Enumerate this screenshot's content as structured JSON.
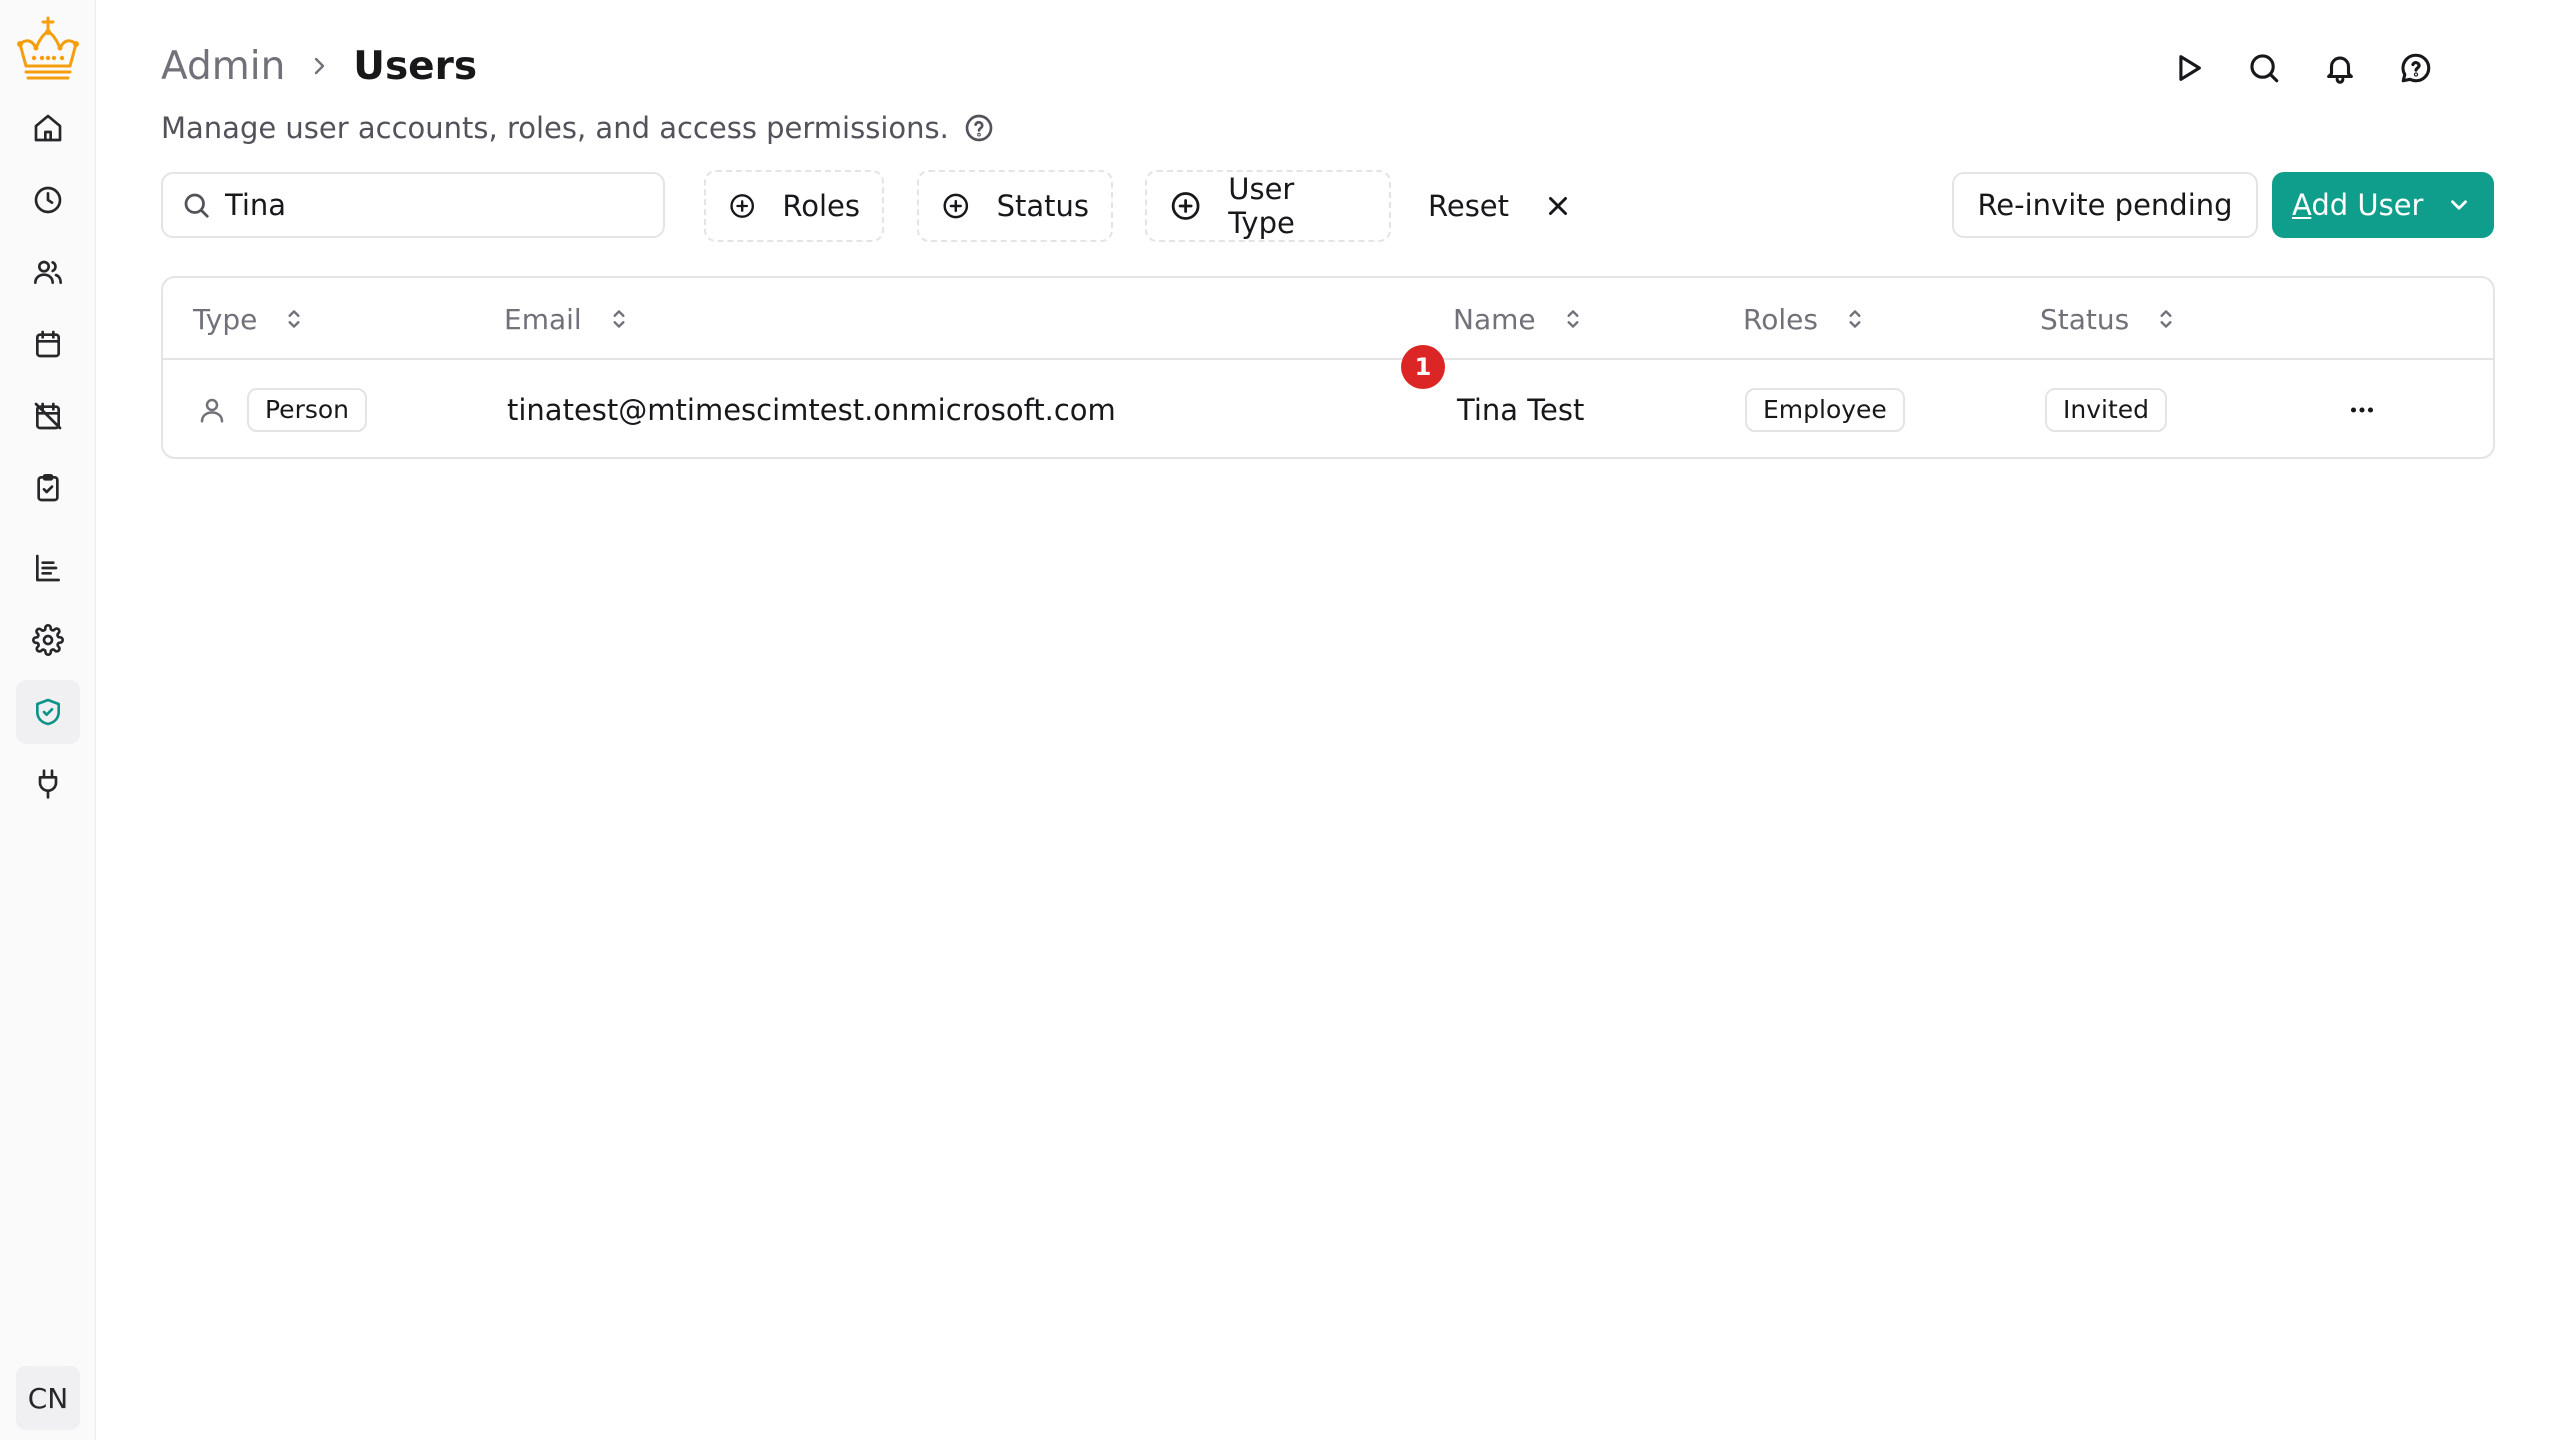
{
  "breadcrumb": {
    "parent": "Admin",
    "current": "Users"
  },
  "subtitle": "Manage user accounts, roles, and access permissions.",
  "search": {
    "value": "Tina",
    "placeholder": ""
  },
  "filters": {
    "roles": "Roles",
    "status": "Status",
    "user_type": "User Type",
    "reset": "Reset"
  },
  "actions": {
    "reinvite": "Re-invite pending",
    "add_user": "Add User"
  },
  "table": {
    "columns": [
      "Type",
      "Email",
      "Name",
      "Roles",
      "Status"
    ],
    "rows": [
      {
        "type": "Person",
        "email": "tinatest@mtimescimtest.onmicrosoft.com",
        "name": "Tina Test",
        "role": "Employee",
        "status": "Invited"
      }
    ]
  },
  "marker": "1",
  "user": {
    "initials": "CN"
  },
  "colors": {
    "accent": "#0f9e8b",
    "marker": "#dc2626",
    "logo": "#f59e0b"
  }
}
